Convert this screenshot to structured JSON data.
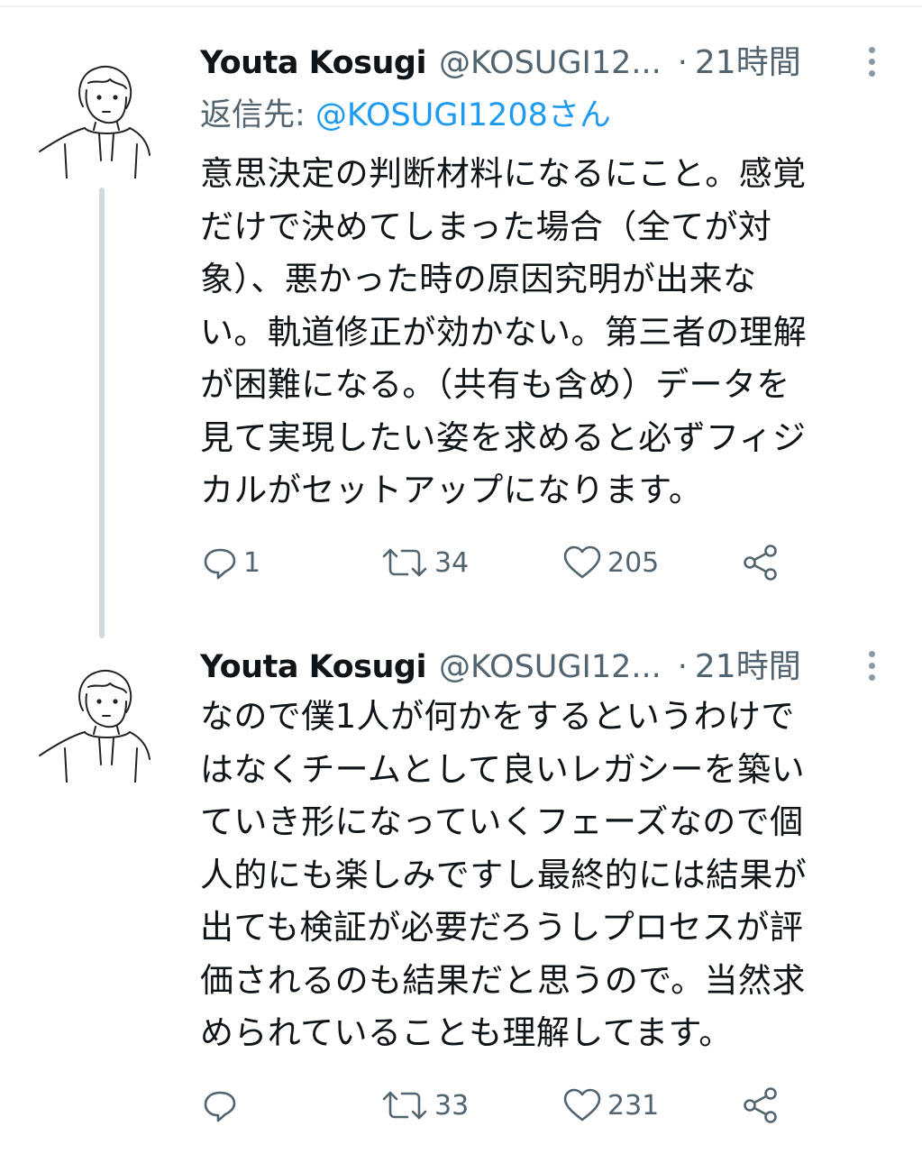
{
  "tweets": [
    {
      "display_name": "Youta Kosugi",
      "handle": "@KOSUGI12...",
      "separator": "·",
      "timestamp": "21時間",
      "reply_to_prefix": "返信先: ",
      "reply_to_mention": "@KOSUGI1208さん",
      "body_lines": [
        "意思決定の判断材料になるにこと。感覚",
        "だけで決めてしまった場合（全てが対",
        "象）、悪かった時の原因究明が出来な",
        "い。軌道修正が効かない。第三者の理解",
        "が困難になる。（共有も含め）データを",
        "見て実現したい姿を求めると必ずフィジ",
        "カルがセットアップになります。"
      ],
      "reply_count": "1",
      "retweet_count": "34",
      "like_count": "205"
    },
    {
      "display_name": "Youta Kosugi",
      "handle": "@KOSUGI12...",
      "separator": "·",
      "timestamp": "21時間",
      "body_lines": [
        "なので僕1人が何かをするというわけで",
        "はなくチームとして良いレガシーを築い",
        "ていき形になっていくフェーズなので個",
        "人的にも楽しみですし最終的には結果が",
        "出ても検証が必要だろうしプロセスが評",
        "価されるのも結果だと思うので。当然求",
        "められていることも理解してます。"
      ],
      "reply_count": "",
      "retweet_count": "33",
      "like_count": "231"
    }
  ],
  "icons": {
    "reply": "reply-icon",
    "retweet": "retweet-icon",
    "like": "heart-icon",
    "share": "share-icon",
    "more": "more-vertical-icon"
  },
  "colors": {
    "text": "#0f1419",
    "secondary": "#536471",
    "link": "#1d9bf0",
    "thread_line": "#cfd9de"
  }
}
